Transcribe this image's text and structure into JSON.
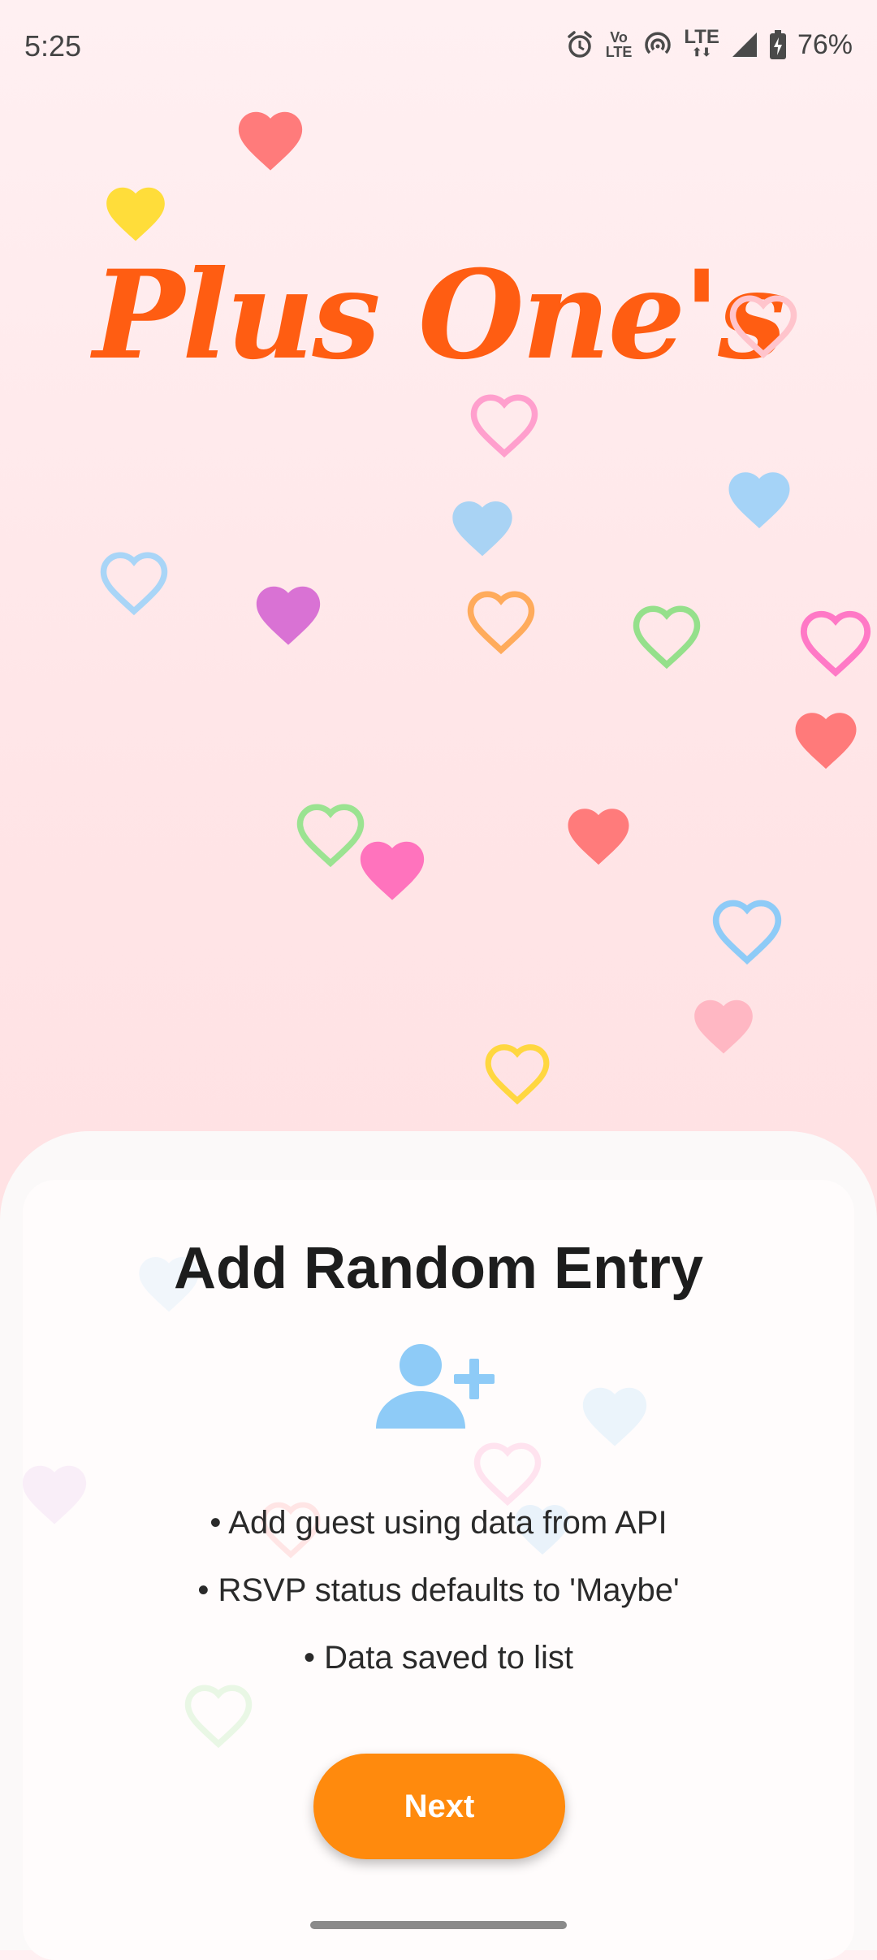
{
  "status_bar": {
    "time": "5:25",
    "lte_label": "LTE",
    "volte_label_top": "Vo",
    "volte_label_bottom": "LTE",
    "battery": "76%",
    "icons": [
      "alarm-icon",
      "volte-icon",
      "hotspot-icon",
      "lte-icon",
      "signal-icon",
      "battery-charging-icon"
    ]
  },
  "app": {
    "title": "Plus One's"
  },
  "card": {
    "title": "Add Random Entry",
    "icon": "add-person-icon",
    "bullets": [
      "• Add guest using data from API",
      "• RSVP status defaults to 'Maybe'",
      "• Data saved to list"
    ],
    "next_label": "Next"
  },
  "colors": {
    "title": "#ff5d12",
    "button": "#ff8a0d",
    "icon": "#8ecbf7",
    "background": "#ffe6e8"
  }
}
